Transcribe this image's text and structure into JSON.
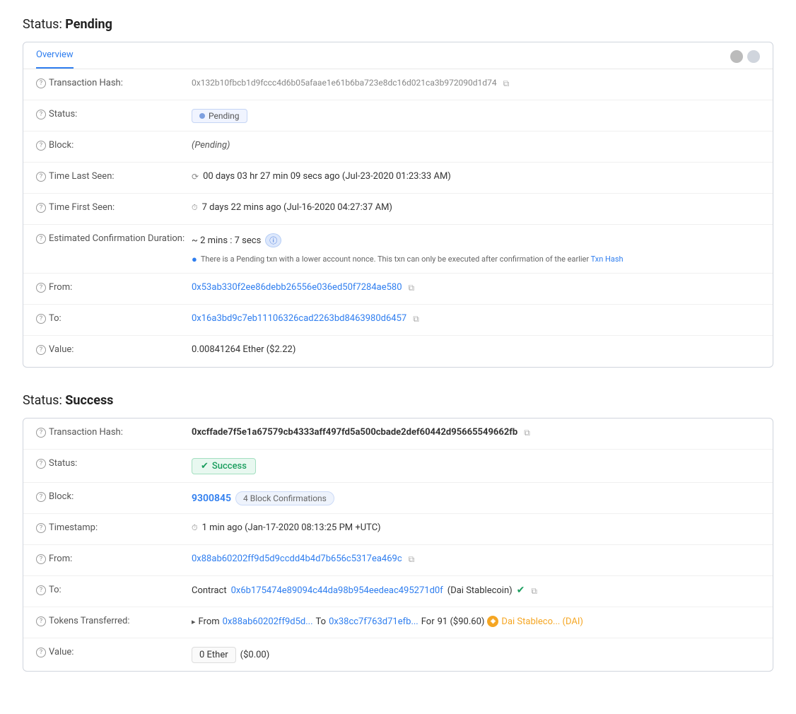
{
  "pending_section": {
    "title_prefix": "Status: ",
    "title_bold": "Pending",
    "tab": "Overview",
    "rows": {
      "tx_hash_label": "Transaction Hash:",
      "tx_hash_value": "0x132b10fbcb1d9fccc4d6b05afaae1e61b6ba723e8dc16d021ca3b972090d1d74",
      "status_label": "Status:",
      "status_value": "Pending",
      "block_label": "Block:",
      "block_value": "(Pending)",
      "time_last_seen_label": "Time Last Seen:",
      "time_last_seen_value": "00 days 03 hr 27 min 09 secs ago (Jul-23-2020 01:23:33 AM)",
      "time_first_seen_label": "Time First Seen:",
      "time_first_seen_value": "7 days 22 mins ago (Jul-16-2020 04:27:37 AM)",
      "est_confirm_label": "Estimated Confirmation Duration:",
      "est_confirm_value": "~ 2 mins : 7 secs",
      "warning_text": "There is a Pending txn with a lower account nonce. This txn can only be executed after confirmation of the earlier Txn Hash",
      "from_label": "From:",
      "from_value": "0x53ab330f2ee86debb26556e036ed50f7284ae580",
      "to_label": "To:",
      "to_value": "0x16a3bd9c7eb11106326cad2263bd8463980d6457",
      "value_label": "Value:",
      "value_value": "0.00841264 Ether ($2.22)"
    }
  },
  "success_section": {
    "title_prefix": "Status: ",
    "title_bold": "Success",
    "rows": {
      "tx_hash_label": "Transaction Hash:",
      "tx_hash_value": "0xcffade7f5e1a67579cb4333aff497fd5a500cbade2def60442d95665549662fb",
      "status_label": "Status:",
      "status_value": "Success",
      "block_label": "Block:",
      "block_num": "9300845",
      "block_confirmations": "4 Block Confirmations",
      "timestamp_label": "Timestamp:",
      "timestamp_value": "1 min ago (Jan-17-2020 08:13:25 PM +UTC)",
      "from_label": "From:",
      "from_value": "0x88ab60202ff9d5d9ccdd4b4d7b656c5317ea469c",
      "to_label": "To:",
      "to_contract_label": "Contract",
      "to_contract_address": "0x6b175474e89094c44da98b954eedeac495271d0f",
      "to_contract_name": "(Dai Stablecoin)",
      "tokens_label": "Tokens Transferred:",
      "tokens_from": "0x88ab60202ff9d5d...",
      "tokens_to": "0x38cc7f763d71efb...",
      "tokens_for_amount": "91 ($90.60)",
      "tokens_dai_label": "Dai Stableco... (DAI)",
      "value_label": "Value:",
      "value_ether": "0 Ether",
      "value_usd": "($0.00)"
    }
  },
  "icons": {
    "help": "?",
    "copy": "⧉",
    "check": "✓",
    "clock": "⏱",
    "spinner": "⟳",
    "info": "ℹ",
    "arrow_right": "▸"
  }
}
